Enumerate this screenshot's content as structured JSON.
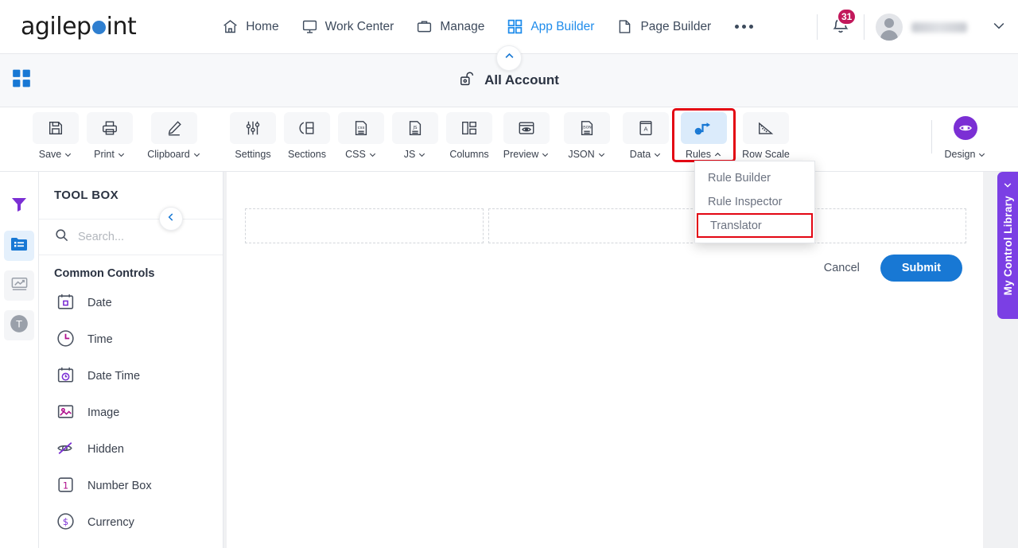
{
  "brand": {
    "name_part1": "agilep",
    "name_part2": "int",
    "dot": "o",
    "accent": "#2f7fd0"
  },
  "header": {
    "nav": [
      {
        "label": "Home",
        "icon": "home-icon",
        "active": false
      },
      {
        "label": "Work Center",
        "icon": "monitor-icon",
        "active": false
      },
      {
        "label": "Manage",
        "icon": "briefcase-icon",
        "active": false
      },
      {
        "label": "App Builder",
        "icon": "grid-icon",
        "active": true
      },
      {
        "label": "Page Builder",
        "icon": "page-icon",
        "active": false
      }
    ],
    "overflow": "...",
    "notifications": {
      "count": "31",
      "icon": "bell-icon"
    },
    "account_caret": "chevron-down-icon"
  },
  "account_bar": {
    "title": "All Account",
    "icon": "unlock-icon",
    "app_grid_icon": "app-grid-icon",
    "collapse_icon": "chevron-up-icon"
  },
  "ribbon": {
    "buttons": [
      {
        "label": "Save",
        "icon": "save-icon",
        "caret": true,
        "state": "normal"
      },
      {
        "label": "Print",
        "icon": "print-icon",
        "caret": true,
        "state": "normal"
      },
      {
        "label": "Clipboard",
        "icon": "pencil-icon",
        "caret": true,
        "state": "normal"
      },
      {
        "label": "Settings",
        "icon": "sliders-icon",
        "caret": false,
        "state": "normal"
      },
      {
        "label": "Sections",
        "icon": "sections-icon",
        "caret": false,
        "state": "normal"
      },
      {
        "label": "CSS",
        "icon": "css-file-icon",
        "caret": true,
        "state": "normal"
      },
      {
        "label": "JS",
        "icon": "js-file-icon",
        "caret": true,
        "state": "normal"
      },
      {
        "label": "Columns",
        "icon": "columns-icon",
        "caret": false,
        "state": "normal"
      },
      {
        "label": "Preview",
        "icon": "eye-window-icon",
        "caret": true,
        "state": "normal"
      },
      {
        "label": "JSON",
        "icon": "json-file-icon",
        "caret": true,
        "state": "normal"
      },
      {
        "label": "Data",
        "icon": "data-book-icon",
        "caret": true,
        "state": "normal"
      },
      {
        "label": "Rules",
        "icon": "rules-flow-icon",
        "caret": true,
        "state": "active-highlighted"
      },
      {
        "label": "Row Scale",
        "icon": "ruler-icon",
        "caret": false,
        "state": "normal"
      }
    ],
    "design": {
      "label": "Design",
      "icon": "eye-circle-icon",
      "caret": true,
      "color": "#7b2fd4"
    },
    "highlight_color": "#e30613"
  },
  "rules_menu": {
    "items": [
      {
        "label": "Rule Builder",
        "highlighted": false
      },
      {
        "label": "Rule Inspector",
        "highlighted": false
      },
      {
        "label": "Translator",
        "highlighted": true
      }
    ]
  },
  "left_rail": [
    {
      "name": "filter-icon",
      "active": false
    },
    {
      "name": "form-list-icon",
      "active": true
    },
    {
      "name": "chart-icon",
      "active": false
    },
    {
      "name": "text-circle-icon",
      "active": false
    }
  ],
  "toolbox": {
    "title": "TOOL BOX",
    "search": {
      "placeholder": "Search...",
      "value": "",
      "icon": "search-icon"
    },
    "group_label": "Common Controls",
    "items": [
      {
        "label": "Date",
        "icon": "calendar-icon"
      },
      {
        "label": "Time",
        "icon": "clock-icon"
      },
      {
        "label": "Date Time",
        "icon": "calendar-clock-icon"
      },
      {
        "label": "Image",
        "icon": "image-icon"
      },
      {
        "label": "Hidden",
        "icon": "eye-off-icon"
      },
      {
        "label": "Number Box",
        "icon": "number-one-icon"
      },
      {
        "label": "Currency",
        "icon": "dollar-icon"
      }
    ],
    "collapse_icon": "chevron-left-icon"
  },
  "canvas": {
    "dropzones": [
      {
        "id": "zone-1"
      },
      {
        "id": "zone-2"
      }
    ],
    "cancel_label": "Cancel",
    "submit_label": "Submit",
    "submit_color": "#1878d4"
  },
  "control_library": {
    "label": "My Control Library",
    "icon": "chevron-left-icon",
    "color": "#7b3fe4"
  }
}
